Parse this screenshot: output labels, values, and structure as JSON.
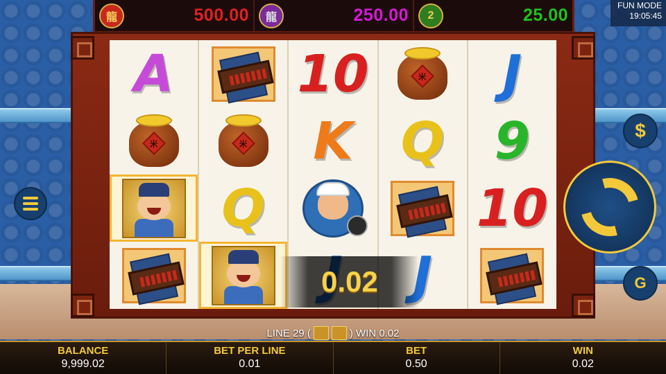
{
  "jackpots": [
    {
      "icon": "dragon-red-icon",
      "value": "500.00",
      "color": "#e02020",
      "ring": "#c8281c"
    },
    {
      "icon": "dragon-silver-icon",
      "value": "250.00",
      "color": "#d21ad6",
      "ring": "#7a2a9a"
    },
    {
      "icon": "coin-2-icon",
      "icon_text": "2",
      "value": "25.00",
      "color": "#1ec21e",
      "ring": "#2e7d1e"
    }
  ],
  "status": {
    "mode": "FUN MODE",
    "time": "19:05:45"
  },
  "reels": [
    [
      {
        "sym": "letter",
        "text": "A",
        "color": "#c64ad8"
      },
      {
        "sym": "pot"
      },
      {
        "sym": "official",
        "win": true
      },
      {
        "sym": "abacus"
      }
    ],
    [
      {
        "sym": "abacus"
      },
      {
        "sym": "pot"
      },
      {
        "sym": "letter",
        "text": "Q",
        "color": "#e8c21a"
      },
      {
        "sym": "official",
        "win": true
      }
    ],
    [
      {
        "sym": "letter",
        "text": "10",
        "color": "#d82020"
      },
      {
        "sym": "letter",
        "text": "K",
        "color": "#ef7a1a"
      },
      {
        "sym": "boy"
      },
      {
        "sym": "letter",
        "text": "J",
        "color": "#1f6fd8"
      }
    ],
    [
      {
        "sym": "pot"
      },
      {
        "sym": "letter",
        "text": "Q",
        "color": "#e8c21a"
      },
      {
        "sym": "abacus"
      },
      {
        "sym": "letter",
        "text": "J",
        "color": "#1f6fd8"
      }
    ],
    [
      {
        "sym": "letter",
        "text": "J",
        "color": "#1f6fd8"
      },
      {
        "sym": "letter",
        "text": "9",
        "color": "#28b52a"
      },
      {
        "sym": "letter",
        "text": "10",
        "color": "#d82020"
      },
      {
        "sym": "abacus"
      }
    ]
  ],
  "win_overlay": "0.02",
  "line_info": {
    "prefix": "LINE 29 (",
    "suffix": ") WIN 0.02"
  },
  "buttons": {
    "coin": "$",
    "auto": "G"
  },
  "bottom": {
    "balance_label": "BALANCE",
    "balance": "9,999.02",
    "bpl_label": "BET PER LINE",
    "bpl": "0.01",
    "bet_label": "BET",
    "bet": "0.50",
    "win_label": "WIN",
    "win": "0.02"
  }
}
